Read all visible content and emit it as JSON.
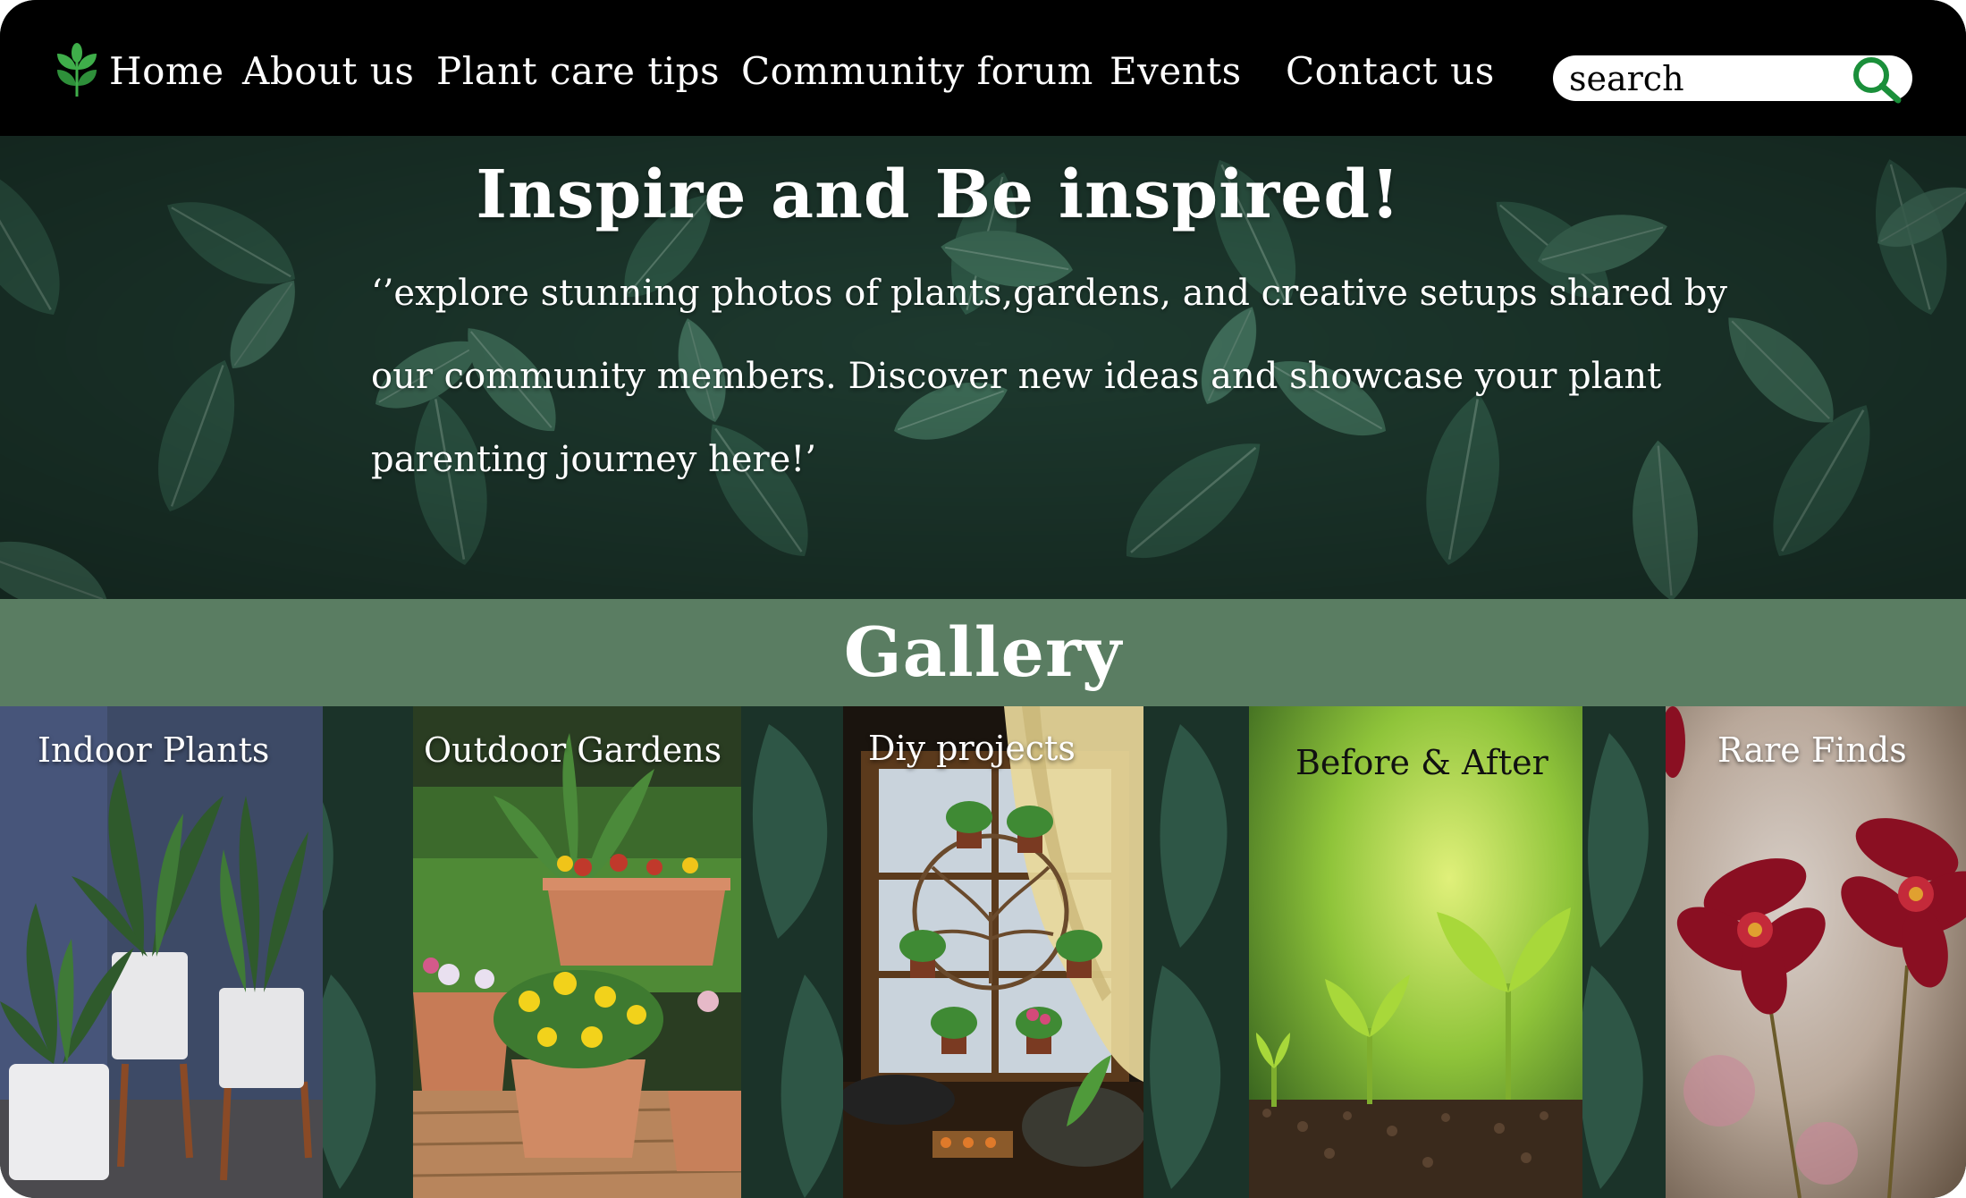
{
  "nav": {
    "links": [
      "Home",
      "About us",
      "Plant care tips",
      "Community forum",
      "Events",
      "Contact us"
    ],
    "search_placeholder": "search"
  },
  "hero": {
    "title": "Inspire and Be inspired!",
    "text": "‘’explore stunning photos of plants,gardens, and creative setups shared by our community members. Discover new ideas and showcase your plant parenting journey here!’"
  },
  "gallery": {
    "title": "Gallery",
    "tiles": [
      "Indoor Plants",
      "Outdoor Gardens",
      "Diy projects",
      "Before & After",
      "Rare Finds"
    ]
  },
  "colors": {
    "nav_bg": "#000000",
    "gallery_bar": "#5a7d62",
    "leaf_dark": "#1f3f33",
    "search_icon": "#1a8f3a",
    "logo_green": "#3fae4a"
  },
  "icons": {
    "logo": "leaf-sprout-icon",
    "search": "search-icon"
  }
}
